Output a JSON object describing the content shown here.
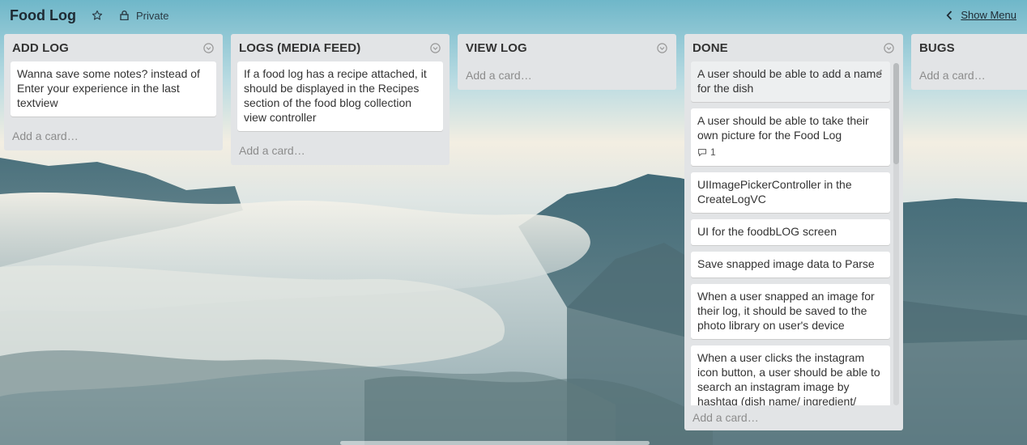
{
  "board": {
    "title": "Food Log",
    "privacy_label": "Private",
    "show_menu_label": "Show Menu",
    "icons": {
      "star": "star-icon",
      "lock": "lock-icon",
      "chevron": "chevron-left-icon"
    }
  },
  "lists": [
    {
      "title": "ADD LOG",
      "cards": [
        {
          "text": "Wanna save some notes? instead of Enter your experience in the last textview"
        }
      ],
      "add_card_label": "Add a card…"
    },
    {
      "title": "LOGS (MEDIA FEED)",
      "cards": [
        {
          "text": "If a food log has a recipe attached, it should be displayed in the Recipes section of the food blog collection view controller"
        }
      ],
      "add_card_label": "Add a card…"
    },
    {
      "title": "VIEW LOG",
      "cards": [],
      "add_card_label": "Add a card…"
    },
    {
      "title": "DONE",
      "cards": [
        {
          "text": "A user should be able to add a name for the dish"
        },
        {
          "text": "A user should be able to take their own picture for the Food Log",
          "comments": "1"
        },
        {
          "text": "UIImagePickerController in the CreateLogVC"
        },
        {
          "text": "UI for the foodbLOG screen"
        },
        {
          "text": "Save snapped image data to Parse"
        },
        {
          "text": "When a user snapped an image for their log, it should be saved to the photo library on user's device"
        },
        {
          "text": "When a user clicks the instagram icon button, a user should be able to search an instagram image by hashtag (dish name/ ingredient/"
        }
      ],
      "add_card_label": "Add a card…"
    },
    {
      "title": "BUGS",
      "cards": [],
      "add_card_label": "Add a card…"
    }
  ]
}
